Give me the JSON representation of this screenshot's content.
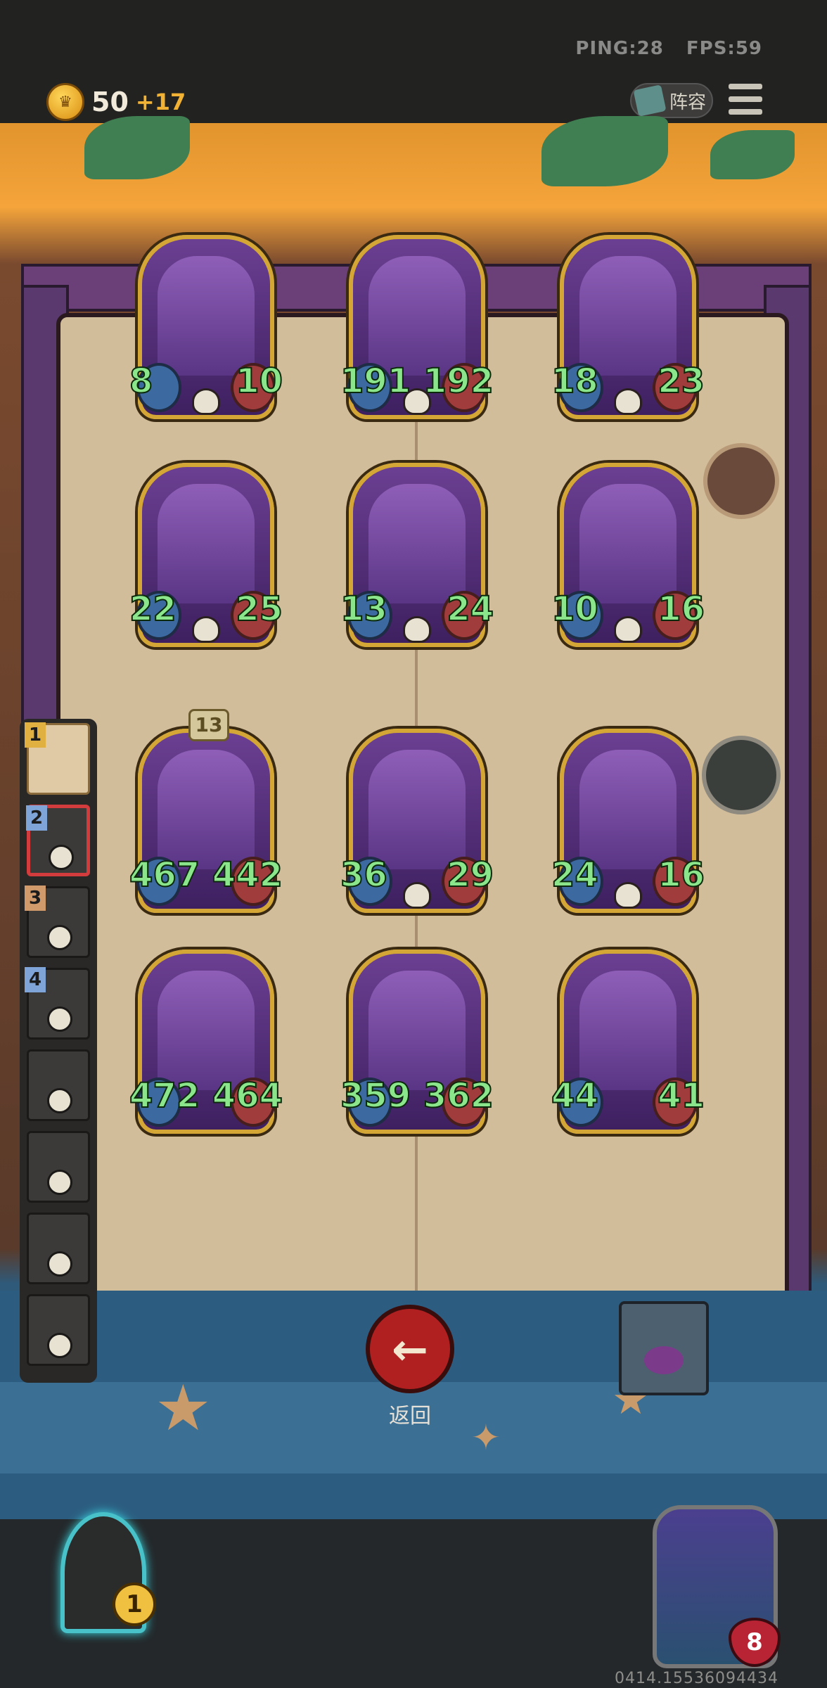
{
  "hud": {
    "ping_label": "PING:28",
    "fps_label": "FPS:59",
    "coins": "50",
    "coin_income": "+17",
    "lineup_label": "阵容"
  },
  "cards": [
    {
      "attack": "8",
      "health": "10"
    },
    {
      "attack": "191",
      "health": "192"
    },
    {
      "attack": "18",
      "health": "23"
    },
    {
      "attack": "22",
      "health": "25"
    },
    {
      "attack": "13",
      "health": "24"
    },
    {
      "attack": "10",
      "health": "16"
    },
    {
      "attack": "467",
      "health": "442",
      "star_level": "13"
    },
    {
      "attack": "36",
      "health": "29"
    },
    {
      "attack": "24",
      "health": "16"
    },
    {
      "attack": "472",
      "health": "464"
    },
    {
      "attack": "359",
      "health": "362"
    },
    {
      "attack": "44",
      "health": "41"
    }
  ],
  "players": [
    {
      "rank": "1"
    },
    {
      "rank": "2"
    },
    {
      "rank": "3"
    },
    {
      "rank": "4"
    },
    {
      "rank": ""
    },
    {
      "rank": ""
    },
    {
      "rank": ""
    },
    {
      "rank": ""
    }
  ],
  "back_button_label": "返回",
  "tavern_level": "1",
  "hero_health": "8",
  "build_id": "0414.15536094434",
  "colors": {
    "stat_text": "#8be58b",
    "card_border": "#d4a635",
    "back_button": "#b02020"
  }
}
